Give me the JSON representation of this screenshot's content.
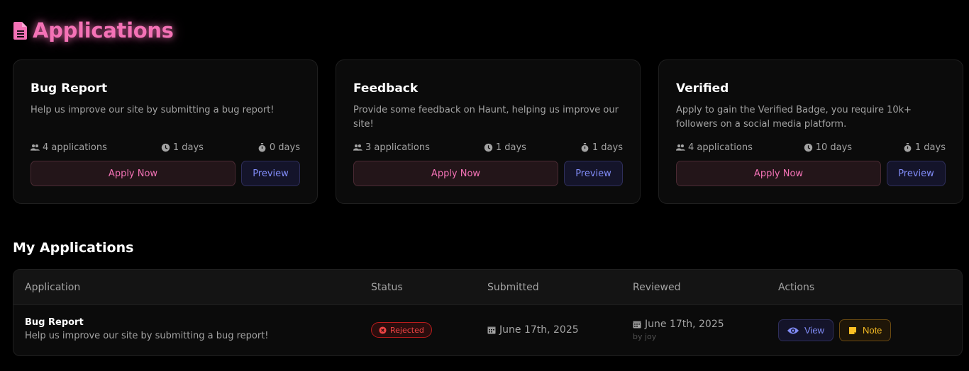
{
  "page": {
    "title": "Applications"
  },
  "application_types": [
    {
      "title": "Bug Report",
      "description": "Help us improve our site by submitting a bug report!",
      "applications": "4 applications",
      "duration": "1 days",
      "timer": "0 days",
      "apply_label": "Apply Now",
      "preview_label": "Preview"
    },
    {
      "title": "Feedback",
      "description": "Provide some feedback on Haunt, helping us improve our site!",
      "applications": "3 applications",
      "duration": "1 days",
      "timer": "1 days",
      "apply_label": "Apply Now",
      "preview_label": "Preview"
    },
    {
      "title": "Verified",
      "description": "Apply to gain the Verified Badge, you require 10k+ followers on a social media platform.",
      "applications": "4 applications",
      "duration": "10 days",
      "timer": "1 days",
      "apply_label": "Apply Now",
      "preview_label": "Preview"
    }
  ],
  "my_applications": {
    "title": "My Applications",
    "columns": [
      "Application",
      "Status",
      "Submitted",
      "Reviewed",
      "Actions"
    ],
    "rows": [
      {
        "name": "Bug Report",
        "description": "Help us improve our site by submitting a bug report!",
        "status": "Rejected",
        "submitted": "June 17th, 2025",
        "reviewed": "June 17th, 2025",
        "reviewed_by": "by joy",
        "view_label": "View",
        "note_label": "Note"
      }
    ]
  },
  "colors": {
    "accent_pink": "#f472b6",
    "accent_indigo": "#818cf8",
    "rejected_red": "#ef4444",
    "note_amber": "#fbbf24"
  },
  "icons": {
    "title": "file-text-icon",
    "applications": "users-icon",
    "duration": "clock-icon",
    "timer": "stopwatch-icon",
    "status": "x-circle-icon",
    "date": "calendar-icon",
    "view": "eye-icon",
    "note": "sticky-note-icon"
  }
}
